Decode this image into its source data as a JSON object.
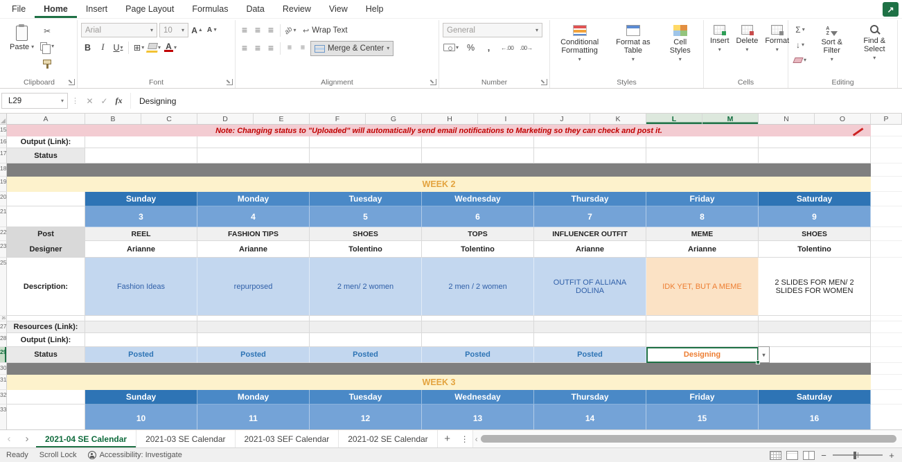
{
  "ribbon_tabs": {
    "items": [
      "File",
      "Home",
      "Insert",
      "Page Layout",
      "Formulas",
      "Data",
      "Review",
      "View",
      "Help"
    ],
    "active": "Home"
  },
  "ribbon": {
    "clipboard": {
      "label": "Clipboard",
      "paste_label": "Paste"
    },
    "font": {
      "label": "Font",
      "font_name": "Arial",
      "font_size": "10"
    },
    "alignment": {
      "label": "Alignment",
      "wrap_text_label": "Wrap Text",
      "merge_center_label": "Merge & Center"
    },
    "number": {
      "label": "Number",
      "format": "General"
    },
    "styles": {
      "label": "Styles",
      "conditional": "Conditional Formatting",
      "format_table": "Format as Table",
      "cell_styles": "Cell Styles"
    },
    "cells": {
      "label": "Cells",
      "insert": "Insert",
      "delete": "Delete",
      "format": "Format"
    },
    "editing": {
      "label": "Editing",
      "sort_filter": "Sort & Filter",
      "find_select": "Find & Select"
    }
  },
  "formula_bar": {
    "name_box": "L29",
    "formula": "Designing"
  },
  "grid": {
    "columns": [
      "A",
      "B",
      "C",
      "D",
      "E",
      "F",
      "G",
      "H",
      "I",
      "J",
      "K",
      "L",
      "M",
      "N",
      "O",
      "P"
    ],
    "selected_columns": [
      "L",
      "M"
    ],
    "selected_cell": "L29",
    "note": "Note: Changing status to \"Uploaded\" will automatically send email notifications to Marketing so they can check and post it.",
    "row_labels": {
      "output": "Output (Link):",
      "status": "Status",
      "post": "Post",
      "designer": "Designer",
      "description": "Description:",
      "resources": "Resources (Link):"
    },
    "row_numbers": [
      "15",
      "16",
      "17",
      "18",
      "19",
      "20",
      "21",
      "22",
      "23",
      "25",
      "26",
      "27",
      "28",
      "29",
      "30",
      "31",
      "32",
      "33"
    ],
    "week2": {
      "title": "WEEK 2",
      "days": [
        "Sunday",
        "Monday",
        "Tuesday",
        "Wednesday",
        "Thursday",
        "Friday",
        "Saturday"
      ],
      "dates": [
        "3",
        "4",
        "5",
        "6",
        "7",
        "8",
        "9"
      ],
      "post": [
        "REEL",
        "FASHION TIPS",
        "SHOES",
        "TOPS",
        "INFLUENCER OUTFIT",
        "MEME",
        "SHOES"
      ],
      "designer": [
        "Arianne",
        "Arianne",
        "Tolentino",
        "Tolentino",
        "Arianne",
        "Arianne",
        "Tolentino"
      ],
      "description": [
        "Fashion Ideas",
        "repurposed",
        "2 men/ 2 women",
        "2 men / 2 women",
        "OUTFIT OF ALLIANA DOLINA",
        "IDK YET, BUT A MEME",
        "2 SLIDES FOR MEN/ 2 SLIDES FOR WOMEN"
      ],
      "status": [
        "Posted",
        "Posted",
        "Posted",
        "Posted",
        "Posted",
        "Designing",
        ""
      ]
    },
    "week3": {
      "title": "WEEK 3",
      "days": [
        "Sunday",
        "Monday",
        "Tuesday",
        "Wednesday",
        "Thursday",
        "Friday",
        "Saturday"
      ],
      "dates": [
        "10",
        "11",
        "12",
        "13",
        "14",
        "15",
        "16"
      ]
    }
  },
  "sheet_tabs": {
    "tabs": [
      "2021-04 SE Calendar",
      "2021-03 SE Calendar",
      "2021-03 SEF Calendar",
      "2021-02 SE Calendar"
    ],
    "active": "2021-04 SE Calendar"
  },
  "status_bar": {
    "mode": "Ready",
    "scroll_lock": "Scroll Lock",
    "accessibility": "Accessibility: Investigate"
  },
  "colors": {
    "accent_green": "#1e7145",
    "weekend_blue": "#2e74b5",
    "weekday_blue": "#4a89c7",
    "date_blue": "#74a3d7",
    "light_blue": "#c3d7ef",
    "cream": "#fdf2cc",
    "orange": "#ed7d31",
    "note_red": "#c00000",
    "divider_gray": "#7f7f7f"
  },
  "icons": {
    "chevron": "▾",
    "cut": "✂",
    "bold": "B",
    "italic": "I",
    "underline": "U",
    "borders": "⊞",
    "font_color_A": "A",
    "grow_A": "A",
    "up_triangle": "▲",
    "down_triangle": "▼",
    "align_lines": "≡",
    "orientation": "ab",
    "wrap_return": "↩",
    "percent": "%",
    "comma": ",",
    "inc_decimal": "←.00",
    "dec_decimal": ".00→",
    "sum": "Σ",
    "down_arrow": "↓",
    "fx": "fx",
    "cancel": "✕",
    "enter": "✓",
    "nav_left": "‹",
    "nav_right": "›",
    "plus": "+",
    "minus": "−",
    "dots": "⋮",
    "share_arrow": "↗"
  }
}
